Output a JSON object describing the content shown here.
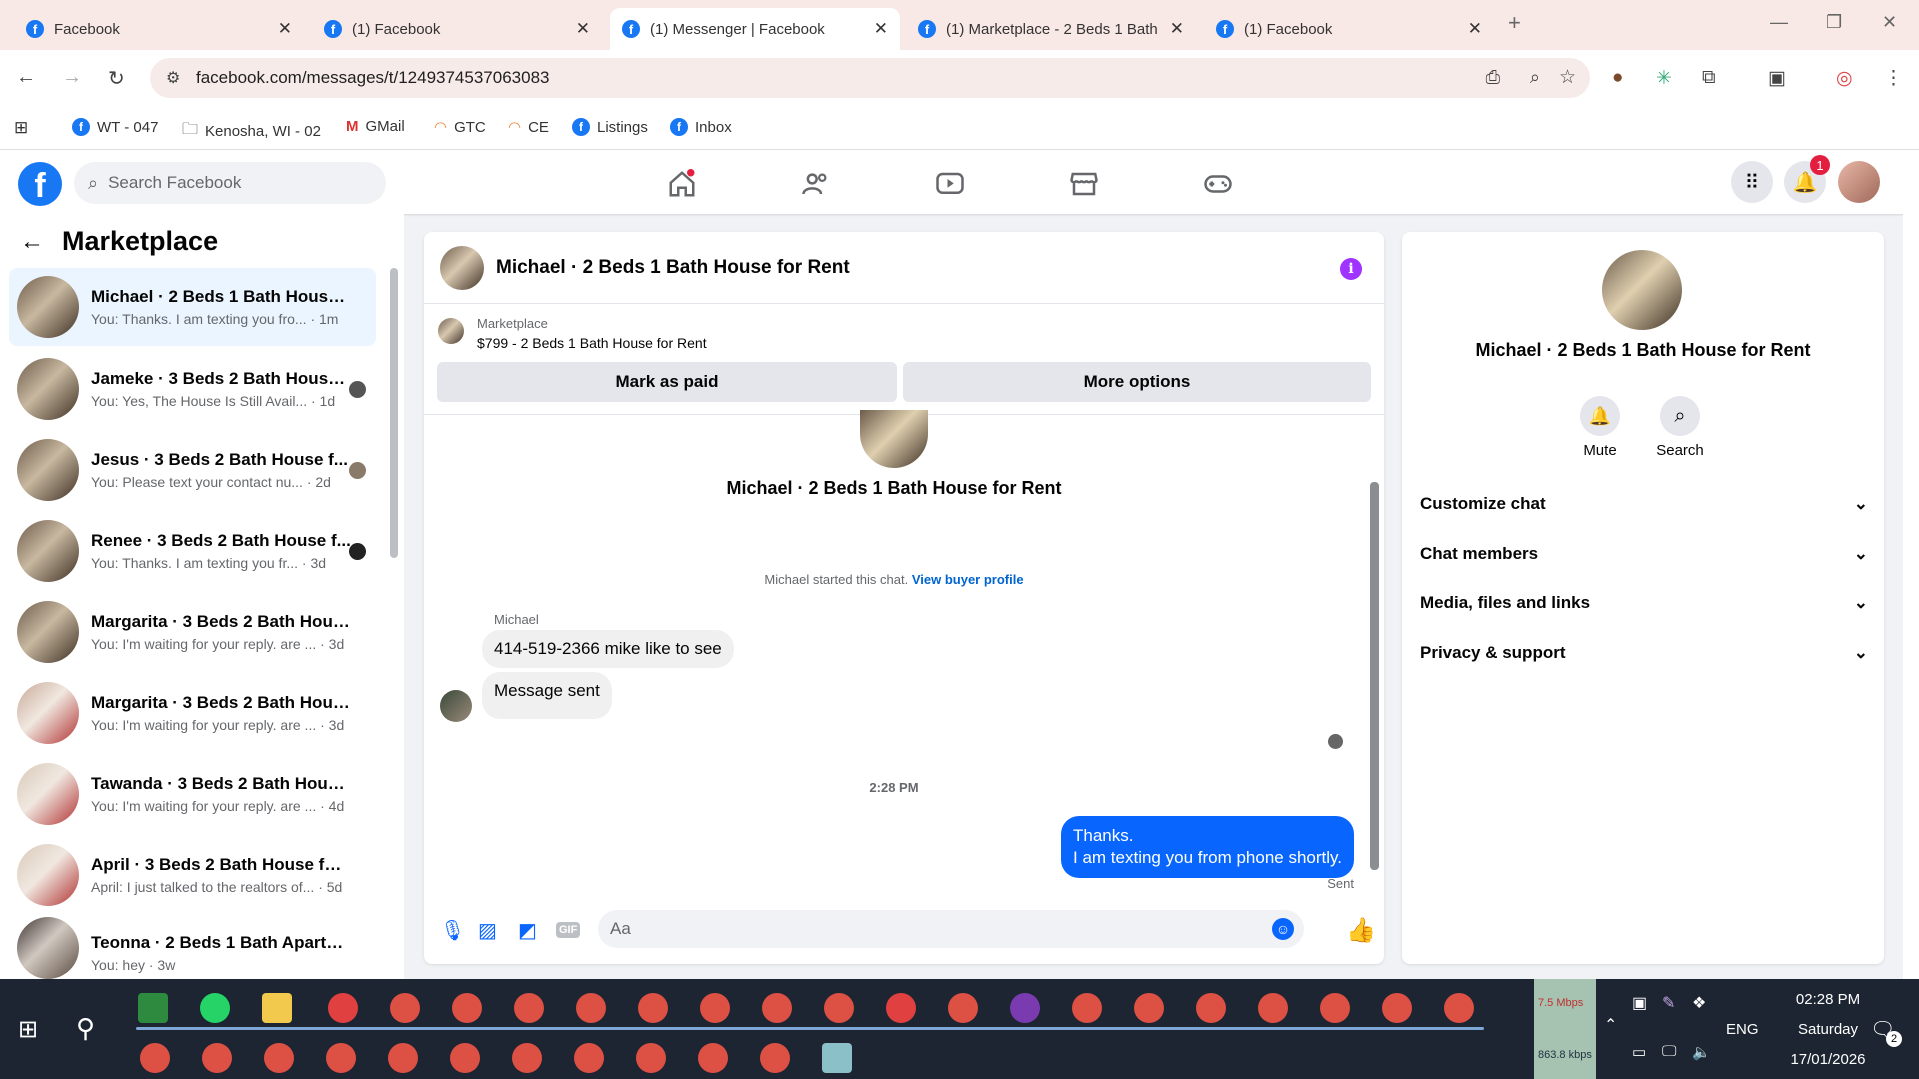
{
  "browser": {
    "tabs": [
      {
        "title": "Facebook",
        "active": false
      },
      {
        "title": "(1) Facebook",
        "active": false
      },
      {
        "title": "(1) Messenger | Facebook",
        "active": true
      },
      {
        "title": "(1) Marketplace - 2 Beds 1 Bath",
        "active": false
      },
      {
        "title": "(1) Facebook",
        "active": false
      }
    ],
    "url": "facebook.com/messages/t/1249374537063083",
    "bookmarks": [
      "WT - 047",
      "Kenosha, WI - 02",
      "GMail",
      "GTC",
      "CE",
      "Listings",
      "Inbox"
    ]
  },
  "fb_header": {
    "search_placeholder": "Search Facebook",
    "notification_count": "1"
  },
  "left_panel": {
    "title": "Marketplace",
    "conversations": [
      {
        "name": "Michael · 2 Beds 1 Bath House f...",
        "snippet": "You: Thanks. I am texting you fro...  · 1m",
        "selected": true
      },
      {
        "name": "Jameke · 3 Beds 2 Bath House...",
        "snippet": "You: Yes, The House Is Still Avail... · 1d"
      },
      {
        "name": "Jesus · 3 Beds 2 Bath House f...",
        "snippet": "You: Please text your contact nu... · 2d"
      },
      {
        "name": "Renee · 3 Beds 2 Bath House f...",
        "snippet": "You: Thanks. I am texting you fr... · 3d"
      },
      {
        "name": "Margarita · 3 Beds 2 Bath House...",
        "snippet": "You: I'm waiting for your reply. are ... · 3d"
      },
      {
        "name": "Margarita · 3 Beds 2 Bath House...",
        "snippet": "You: I'm waiting for your reply. are ... · 3d"
      },
      {
        "name": "Tawanda · 3 Beds 2 Bath House ...",
        "snippet": "You: I'm waiting for your reply. are ... · 4d"
      },
      {
        "name": "April · 3 Beds 2 Bath House for ...",
        "snippet": "April: I just talked to the realtors of... · 5d"
      },
      {
        "name": "Teonna · 2 Beds 1 Bath Apartment",
        "snippet": "You: hey · 3w"
      }
    ]
  },
  "chat": {
    "header_title": "Michael · 2 Beds 1 Bath House for Rent",
    "listing_label": "Marketplace",
    "listing_title": "$799 - 2 Beds 1 Bath House for Rent",
    "mark_paid": "Mark as paid",
    "more_options": "More options",
    "intro_title": "Michael · 2 Beds 1 Bath House for Rent",
    "started_text": "Michael started this chat.",
    "buyer_profile_link": "View buyer profile",
    "sender_name": "Michael",
    "messages_in": [
      "414-519-2366  mike like to see",
      "Message sent"
    ],
    "timestamp": "2:28 PM",
    "my_message_line1": "Thanks.",
    "my_message_line2": "I am texting you from phone shortly.",
    "sent_status": "Sent",
    "composer_placeholder": "Aa"
  },
  "right_panel": {
    "title": "Michael · 2 Beds 1 Bath House for Rent",
    "mute": "Mute",
    "search": "Search",
    "sections": [
      "Customize chat",
      "Chat members",
      "Media, files and links",
      "Privacy & support"
    ]
  },
  "taskbar": {
    "net_up": "7.5 Mbps",
    "net_down": "863.8 kbps",
    "lang": "ENG",
    "time": "02:28 PM",
    "day": "Saturday",
    "date": "17/01/2026",
    "notif": "2"
  },
  "colors": {
    "fb_blue": "#1877f2",
    "my_bubble": "#0866ff",
    "info_purple": "#a033ff"
  }
}
